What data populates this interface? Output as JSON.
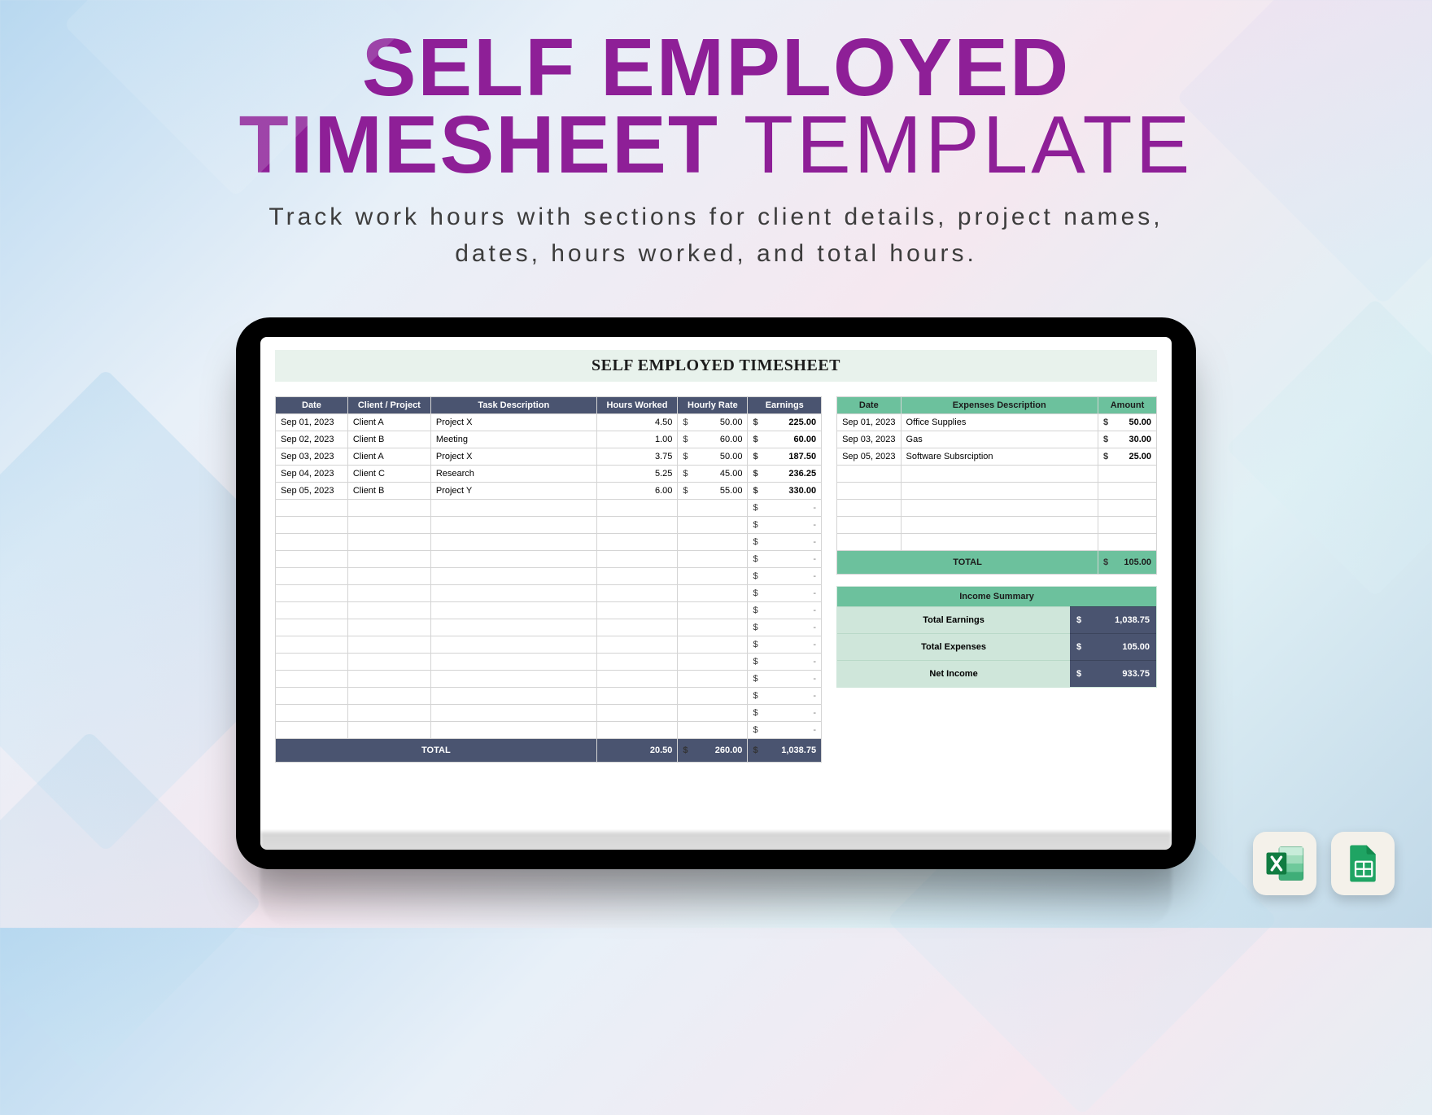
{
  "title_line1": "SELF EMPLOYED",
  "title_line2a": "TIMESHEET",
  "title_line2b": " TEMPLATE",
  "subtitle_line1": "Track work hours with sections for client details, project names,",
  "subtitle_line2": "dates, hours worked, and total hours.",
  "sheet_title": "SELF EMPLOYED TIMESHEET",
  "timesheet": {
    "headers": {
      "date": "Date",
      "client": "Client / Project",
      "task": "Task Description",
      "hours": "Hours Worked",
      "rate": "Hourly Rate",
      "earnings": "Earnings"
    },
    "rows": [
      {
        "date": "Sep 01, 2023",
        "client": "Client A",
        "task": "Project X",
        "hours": "4.50",
        "rate": "50.00",
        "earnings": "225.00"
      },
      {
        "date": "Sep 02, 2023",
        "client": "Client B",
        "task": "Meeting",
        "hours": "1.00",
        "rate": "60.00",
        "earnings": "60.00"
      },
      {
        "date": "Sep 03, 2023",
        "client": "Client A",
        "task": "Project X",
        "hours": "3.75",
        "rate": "50.00",
        "earnings": "187.50"
      },
      {
        "date": "Sep 04, 2023",
        "client": "Client C",
        "task": "Research",
        "hours": "5.25",
        "rate": "45.00",
        "earnings": "236.25"
      },
      {
        "date": "Sep 05, 2023",
        "client": "Client B",
        "task": "Project Y",
        "hours": "6.00",
        "rate": "55.00",
        "earnings": "330.00"
      }
    ],
    "empty_earning": "-",
    "total_label": "TOTAL",
    "total_hours": "20.50",
    "total_rate": "260.00",
    "total_earnings": "1,038.75"
  },
  "expenses": {
    "headers": {
      "date": "Date",
      "desc": "Expenses Description",
      "amount": "Amount"
    },
    "rows": [
      {
        "date": "Sep 01, 2023",
        "desc": "Office Supplies",
        "amount": "50.00"
      },
      {
        "date": "Sep 03, 2023",
        "desc": "Gas",
        "amount": "30.00"
      },
      {
        "date": "Sep 05, 2023",
        "desc": "Software Subsrciption",
        "amount": "25.00"
      }
    ],
    "total_label": "TOTAL",
    "total_amount": "105.00"
  },
  "summary": {
    "header": "Income Summary",
    "rows": [
      {
        "label": "Total Earnings",
        "value": "1,038.75"
      },
      {
        "label": "Total Expenses",
        "value": "105.00"
      },
      {
        "label": "Net Income",
        "value": "933.75"
      }
    ]
  },
  "badges": {
    "excel": "Excel",
    "sheets": "Google Sheets"
  }
}
